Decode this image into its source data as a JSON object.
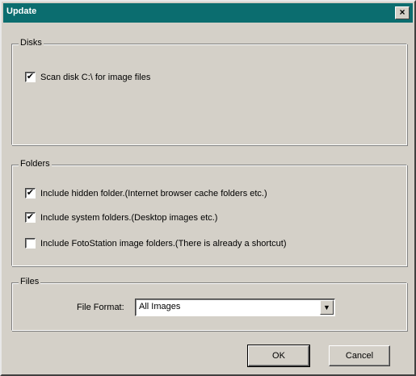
{
  "window": {
    "title": "Update",
    "close_glyph": "×"
  },
  "disks": {
    "legend": "Disks",
    "items": [
      {
        "label": "Scan disk C:\\ for image files",
        "checked": true
      }
    ]
  },
  "folders": {
    "legend": "Folders",
    "items": [
      {
        "label": "Include hidden folder.(Internet browser cache folders etc.)",
        "checked": true
      },
      {
        "label": "Include system folders.(Desktop images etc.)",
        "checked": true
      },
      {
        "label": "Include FotoStation image folders.(There is already a shortcut)",
        "checked": false
      }
    ]
  },
  "files": {
    "legend": "Files",
    "file_format_label": "File Format:",
    "file_format_value": "All Images"
  },
  "buttons": {
    "ok": "OK",
    "cancel": "Cancel"
  },
  "icons": {
    "check": "✔",
    "dropdown": "▼"
  }
}
